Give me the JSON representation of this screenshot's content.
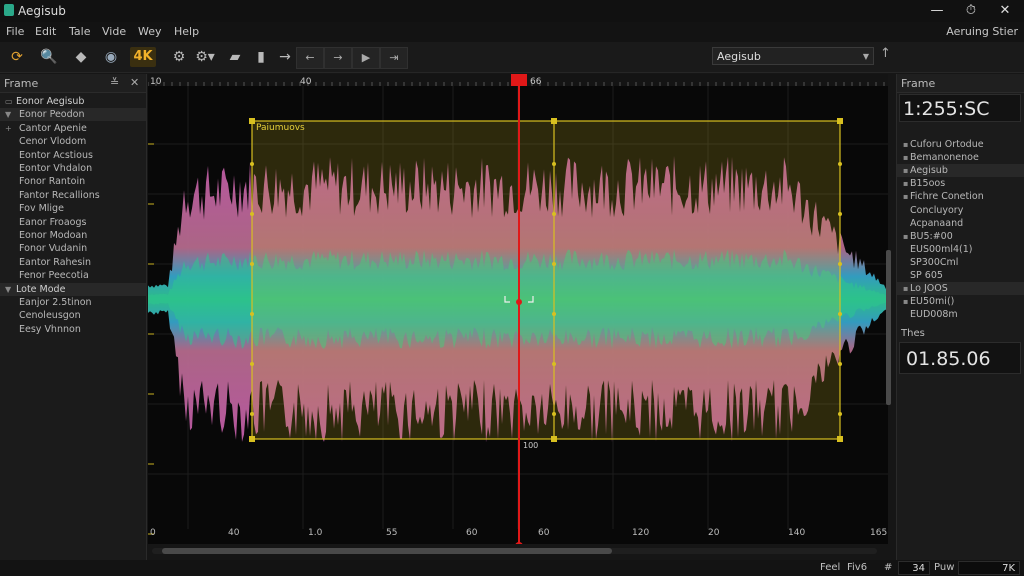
{
  "window": {
    "title": "Aegisub",
    "controls": [
      "—",
      "⏱",
      "✕"
    ]
  },
  "menu": {
    "items": [
      "File",
      "Edit",
      "Tale",
      "Vide",
      "Wey",
      "Help"
    ],
    "right": "Aeruing Stier"
  },
  "toolbar": {
    "badge_4k": "4K",
    "style_select": "Aegisub",
    "up_arrow": "↑"
  },
  "left_panel": {
    "title": "Frame",
    "buttons": [
      "≚",
      "✕"
    ],
    "rows": [
      {
        "bullet": "▭",
        "text": "Eonor Aegisub",
        "group": true,
        "selected": false
      },
      {
        "bullet": "▼",
        "text": "Eonor Peodon",
        "group": false,
        "selected": true
      },
      {
        "bullet": "+",
        "text": "Cantor Apenie",
        "group": false,
        "selected": false
      },
      {
        "bullet": "",
        "text": "Cenor Vlodom",
        "group": false,
        "selected": false
      },
      {
        "bullet": "",
        "text": "Eontor Acstious",
        "group": false,
        "selected": false
      },
      {
        "bullet": "",
        "text": "Eontor Vhdalon",
        "group": false,
        "selected": false
      },
      {
        "bullet": "",
        "text": "Fonor Rantoin",
        "group": false,
        "selected": false
      },
      {
        "bullet": "",
        "text": "Fantor Recallions",
        "group": false,
        "selected": false
      },
      {
        "bullet": "",
        "text": "Fov Mlige",
        "group": false,
        "selected": false
      },
      {
        "bullet": "",
        "text": "Eanor Froaogs",
        "group": false,
        "selected": false
      },
      {
        "bullet": "",
        "text": "Eonor Modoan",
        "group": false,
        "selected": false
      },
      {
        "bullet": "",
        "text": "Fonor Vudanin",
        "group": false,
        "selected": false
      },
      {
        "bullet": "",
        "text": "Eantor Rahesin",
        "group": false,
        "selected": false
      },
      {
        "bullet": "",
        "text": "Fenor Peecotia",
        "group": false,
        "selected": false
      },
      {
        "bullet": "▼",
        "text": "Lote Mode",
        "group": true,
        "selected": true
      },
      {
        "bullet": "",
        "text": "Eanjor 2.5tinon",
        "group": false,
        "selected": false
      },
      {
        "bullet": "",
        "text": "Cenoleusgon",
        "group": false,
        "selected": false
      },
      {
        "bullet": "",
        "text": "Eesy Vhnnon",
        "group": false,
        "selected": false
      }
    ]
  },
  "waveform": {
    "top_ruler_labels": [
      "10",
      "40",
      "66"
    ],
    "bottom_ruler_labels": [
      "0",
      "40",
      "1.0",
      "55",
      "60",
      "60",
      "120",
      "20",
      "140",
      "165"
    ],
    "selection_label": "Paiumuovs",
    "cursor_label": "100",
    "colors": {
      "selection": "#d8c020",
      "cursor": "#e01818",
      "wave_top": "#c05aa8",
      "wave_mid": "#2ec68e",
      "wave_blue": "#35a3c8"
    }
  },
  "right_panel": {
    "title": "Frame",
    "current_time": "1:255:SC",
    "rows": [
      {
        "bullet": "▪",
        "text": "Cuforu Ortodue",
        "selected": false
      },
      {
        "bullet": "▪",
        "text": "Bemanonenoe",
        "selected": false
      },
      {
        "bullet": "▪",
        "text": "Aegisub",
        "selected": true
      },
      {
        "bullet": "▪",
        "text": "B15oos",
        "selected": false
      },
      {
        "bullet": "▪",
        "text": "Fichre Conetion",
        "selected": false
      },
      {
        "bullet": "",
        "text": "Concluyory",
        "selected": false
      },
      {
        "bullet": "",
        "text": "Acpanaand",
        "selected": false
      },
      {
        "bullet": "▪",
        "text": "BU5:#00",
        "selected": false
      },
      {
        "bullet": "",
        "text": "EUS00ml4(1)",
        "selected": false
      },
      {
        "bullet": "",
        "text": "SP300Cml",
        "selected": false
      },
      {
        "bullet": "",
        "text": "SP 605",
        "selected": false
      },
      {
        "bullet": "▪",
        "text": "Lo JOOS",
        "selected": true
      },
      {
        "bullet": "▪",
        "text": "EU50mi()",
        "selected": false
      },
      {
        "bullet": "",
        "text": "EUD008m",
        "selected": false
      }
    ],
    "duration_label": "Thes",
    "duration": "01.85.06"
  },
  "status": {
    "fps_label": "Feel",
    "fps_value": "Fiv6",
    "hash": "#",
    "frame": "34",
    "pos_label": "Puw",
    "pos_value": "7K"
  }
}
